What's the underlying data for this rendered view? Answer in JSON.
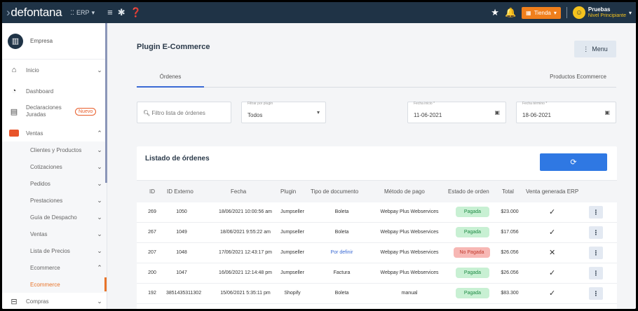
{
  "topbar": {
    "logo": "defontana",
    "module": "ERP",
    "store_label": "Tienda",
    "user_name": "Pruebas",
    "user_level": "Nivel Principiante"
  },
  "sidebar": {
    "company": "Empresa",
    "items": [
      {
        "label": "Inicio"
      },
      {
        "label": "Dashboard"
      },
      {
        "label": "Declaraciones Juradas",
        "badge": "Nuevo"
      },
      {
        "label": "Ventas"
      },
      {
        "label": "Clientes y Productos"
      },
      {
        "label": "Cotizaciones"
      },
      {
        "label": "Pedidos"
      },
      {
        "label": "Prestaciones"
      },
      {
        "label": "Guía de Despacho"
      },
      {
        "label": "Ventas"
      },
      {
        "label": "Lista de Precios"
      },
      {
        "label": "Ecommerce"
      },
      {
        "label": "Ecommerce"
      },
      {
        "label": "Compras"
      }
    ]
  },
  "main": {
    "title": "Plugin E-Commerce",
    "menu_label": "Menu",
    "tabs": [
      "Órdenes",
      "Productos Ecommerce"
    ],
    "filters": {
      "search_placeholder": "Filtro lista de órdenes",
      "plugin_caption": "Filtrar por plugin",
      "plugin_value": "Todos",
      "start_caption": "Fecha inicio *",
      "start_value": "11-06-2021",
      "end_caption": "Fecha término *",
      "end_value": "18-06-2021"
    }
  },
  "orders": {
    "title": "Listado de órdenes",
    "columns": [
      "ID",
      "ID Externo",
      "Fecha",
      "Plugin",
      "Tipo de documento",
      "Método de pago",
      "Estado de orden",
      "Total",
      "Venta generada ERP"
    ],
    "rows": [
      {
        "id": "269",
        "ext": "1050",
        "date": "18/06/2021 10:00:56 am",
        "plugin": "Jumpseller",
        "doc": "Boleta",
        "pay": "Webpay Plus Webservices",
        "status": "Pagada",
        "total": "$23.000",
        "erp": "✓"
      },
      {
        "id": "267",
        "ext": "1049",
        "date": "18/06/2021 9:55:22 am",
        "plugin": "Jumpseller",
        "doc": "Boleta",
        "pay": "Webpay Plus Webservices",
        "status": "Pagada",
        "total": "$17.056",
        "erp": "✓"
      },
      {
        "id": "207",
        "ext": "1048",
        "date": "17/06/2021 12:43:17 pm",
        "plugin": "Jumpseller",
        "doc": "Por definir",
        "pay": "Webpay Plus Webservices",
        "status": "No Pagada",
        "total": "$26.056",
        "erp": "✕"
      },
      {
        "id": "200",
        "ext": "1047",
        "date": "16/06/2021 12:14:48 pm",
        "plugin": "Jumpseller",
        "doc": "Factura",
        "pay": "Webpay Plus Webservices",
        "status": "Pagada",
        "total": "$26.056",
        "erp": "✓"
      },
      {
        "id": "192",
        "ext": "3851435311302",
        "date": "15/06/2021 5:35:11 pm",
        "plugin": "Shopify",
        "doc": "Boleta",
        "pay": "manual",
        "status": "Pagada",
        "total": "$83.300",
        "erp": "✓"
      }
    ]
  },
  "colors": {
    "topbar": "#1f3346",
    "accent": "#e8742a",
    "primary": "#2f78e3"
  }
}
